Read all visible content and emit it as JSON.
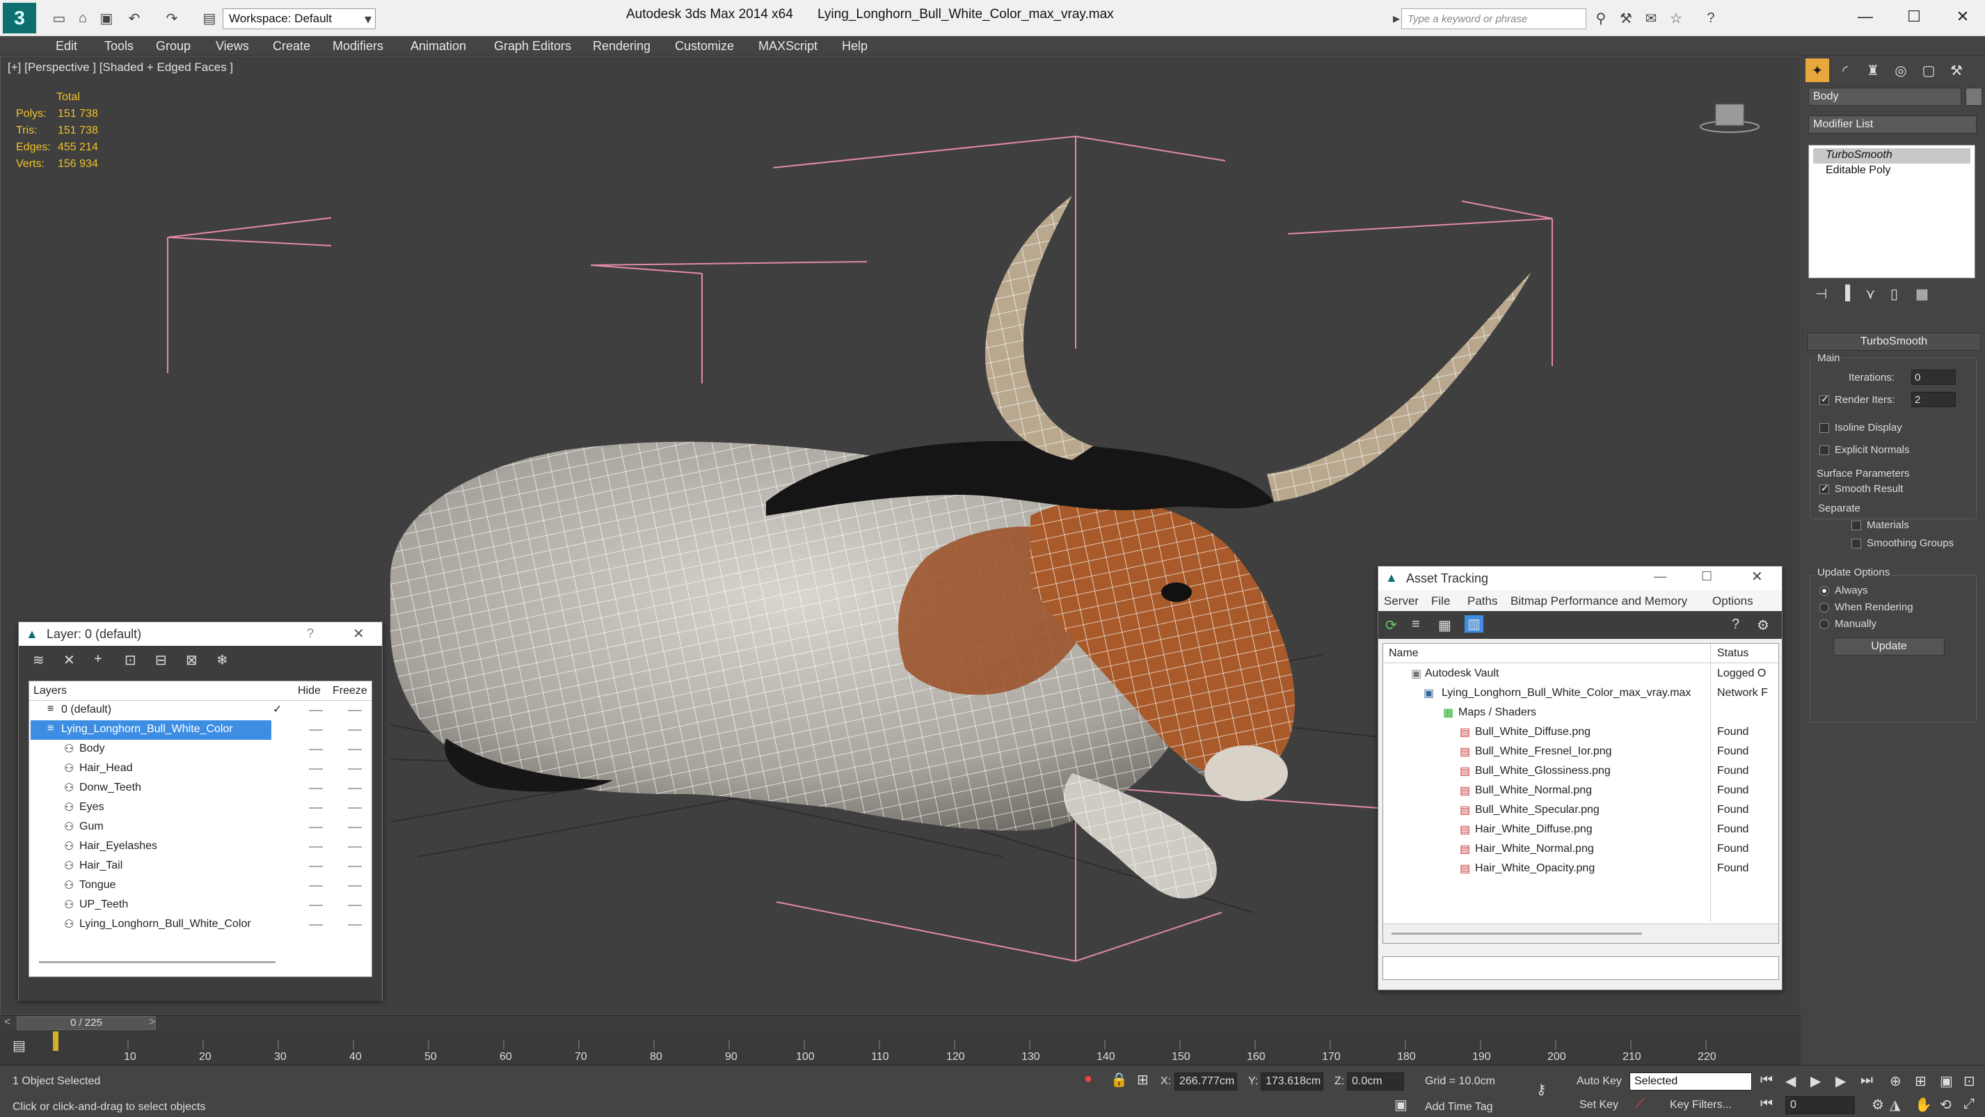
{
  "app": {
    "logo": "3",
    "title_app": "Autodesk 3ds Max  2014 x64",
    "title_file": "Lying_Longhorn_Bull_White_Color_max_vray.max",
    "workspace": "Workspace: Default",
    "search_placeholder": "Type a keyword or phrase"
  },
  "menu": [
    "Edit",
    "Tools",
    "Group",
    "Views",
    "Create",
    "Modifiers",
    "Animation",
    "Graph Editors",
    "Rendering",
    "Customize",
    "MAXScript",
    "Help"
  ],
  "viewport": {
    "label": "[+] [Perspective ] [Shaded + Edged Faces ]",
    "stats_header": "Total",
    "stats": [
      {
        "label": "Polys:",
        "value": "151 738"
      },
      {
        "label": "Tris:",
        "value": "151 738"
      },
      {
        "label": "Edges:",
        "value": "455 214"
      },
      {
        "label": "Verts:",
        "value": "156 934"
      }
    ]
  },
  "command_panel": {
    "object_name": "Body",
    "modifier_list": "Modifier List",
    "stack": [
      "TurboSmooth",
      "Editable Poly"
    ],
    "rollout_title": "TurboSmooth",
    "main_label": "Main",
    "iterations_label": "Iterations:",
    "iterations_value": "0",
    "render_iters_label": "Render Iters:",
    "render_iters_value": "2",
    "isoline": "Isoline Display",
    "explicit_normals": "Explicit Normals",
    "surface_params": "Surface Parameters",
    "smooth_result": "Smooth Result",
    "separate": "Separate",
    "materials": "Materials",
    "smoothing_groups": "Smoothing Groups",
    "update_options": "Update Options",
    "always": "Always",
    "when_rendering": "When Rendering",
    "manually": "Manually",
    "update_button": "Update"
  },
  "layer_manager": {
    "title": "Layer: 0 (default)",
    "help": "?",
    "col_layers": "Layers",
    "col_hide": "Hide",
    "col_freeze": "Freeze",
    "layers": [
      "0 (default)",
      "Lying_Longhorn_Bull_White_Color",
      "Body",
      "Hair_Head",
      "Donw_Teeth",
      "Eyes",
      "Gum",
      "Hair_Eyelashes",
      "Hair_Tail",
      "Tongue",
      "UP_Teeth",
      "Lying_Longhorn_Bull_White_Color"
    ]
  },
  "asset_tracking": {
    "title": "Asset Tracking",
    "menu": [
      "Server",
      "File",
      "Paths",
      "Bitmap Performance and Memory",
      "Options"
    ],
    "col_name": "Name",
    "col_status": "Status",
    "rows": [
      {
        "name": "Autodesk Vault",
        "status": "Logged O"
      },
      {
        "name": "Lying_Longhorn_Bull_White_Color_max_vray.max",
        "status": "Network F"
      },
      {
        "name": "Maps / Shaders",
        "status": ""
      },
      {
        "name": "Bull_White_Diffuse.png",
        "status": "Found"
      },
      {
        "name": "Bull_White_Fresnel_Ior.png",
        "status": "Found"
      },
      {
        "name": "Bull_White_Glossiness.png",
        "status": "Found"
      },
      {
        "name": "Bull_White_Normal.png",
        "status": "Found"
      },
      {
        "name": "Bull_White_Specular.png",
        "status": "Found"
      },
      {
        "name": "Hair_White_Diffuse.png",
        "status": "Found"
      },
      {
        "name": "Hair_White_Normal.png",
        "status": "Found"
      },
      {
        "name": "Hair_White_Opacity.png",
        "status": "Found"
      }
    ]
  },
  "timeline": {
    "frame": "0 / 225",
    "ticks": [
      "10",
      "20",
      "30",
      "40",
      "50",
      "60",
      "70",
      "80",
      "90",
      "100",
      "110",
      "120",
      "130",
      "140",
      "150",
      "160",
      "170",
      "180",
      "190",
      "200",
      "210",
      "220"
    ]
  },
  "status": {
    "selected": "1 Object Selected",
    "prompt": "Click or click-and-drag to select objects",
    "x_label": "X:",
    "x_value": "266.777cm",
    "y_label": "Y:",
    "y_value": "173.618cm",
    "z_label": "Z:",
    "z_value": "0.0cm",
    "grid": "Grid = 10.0cm",
    "auto_key": "Auto Key",
    "selected_dropdown": "Selected",
    "set_key": "Set Key",
    "key_filters": "Key Filters...",
    "add_time_tag": "Add Time Tag",
    "frame_value": "0"
  }
}
